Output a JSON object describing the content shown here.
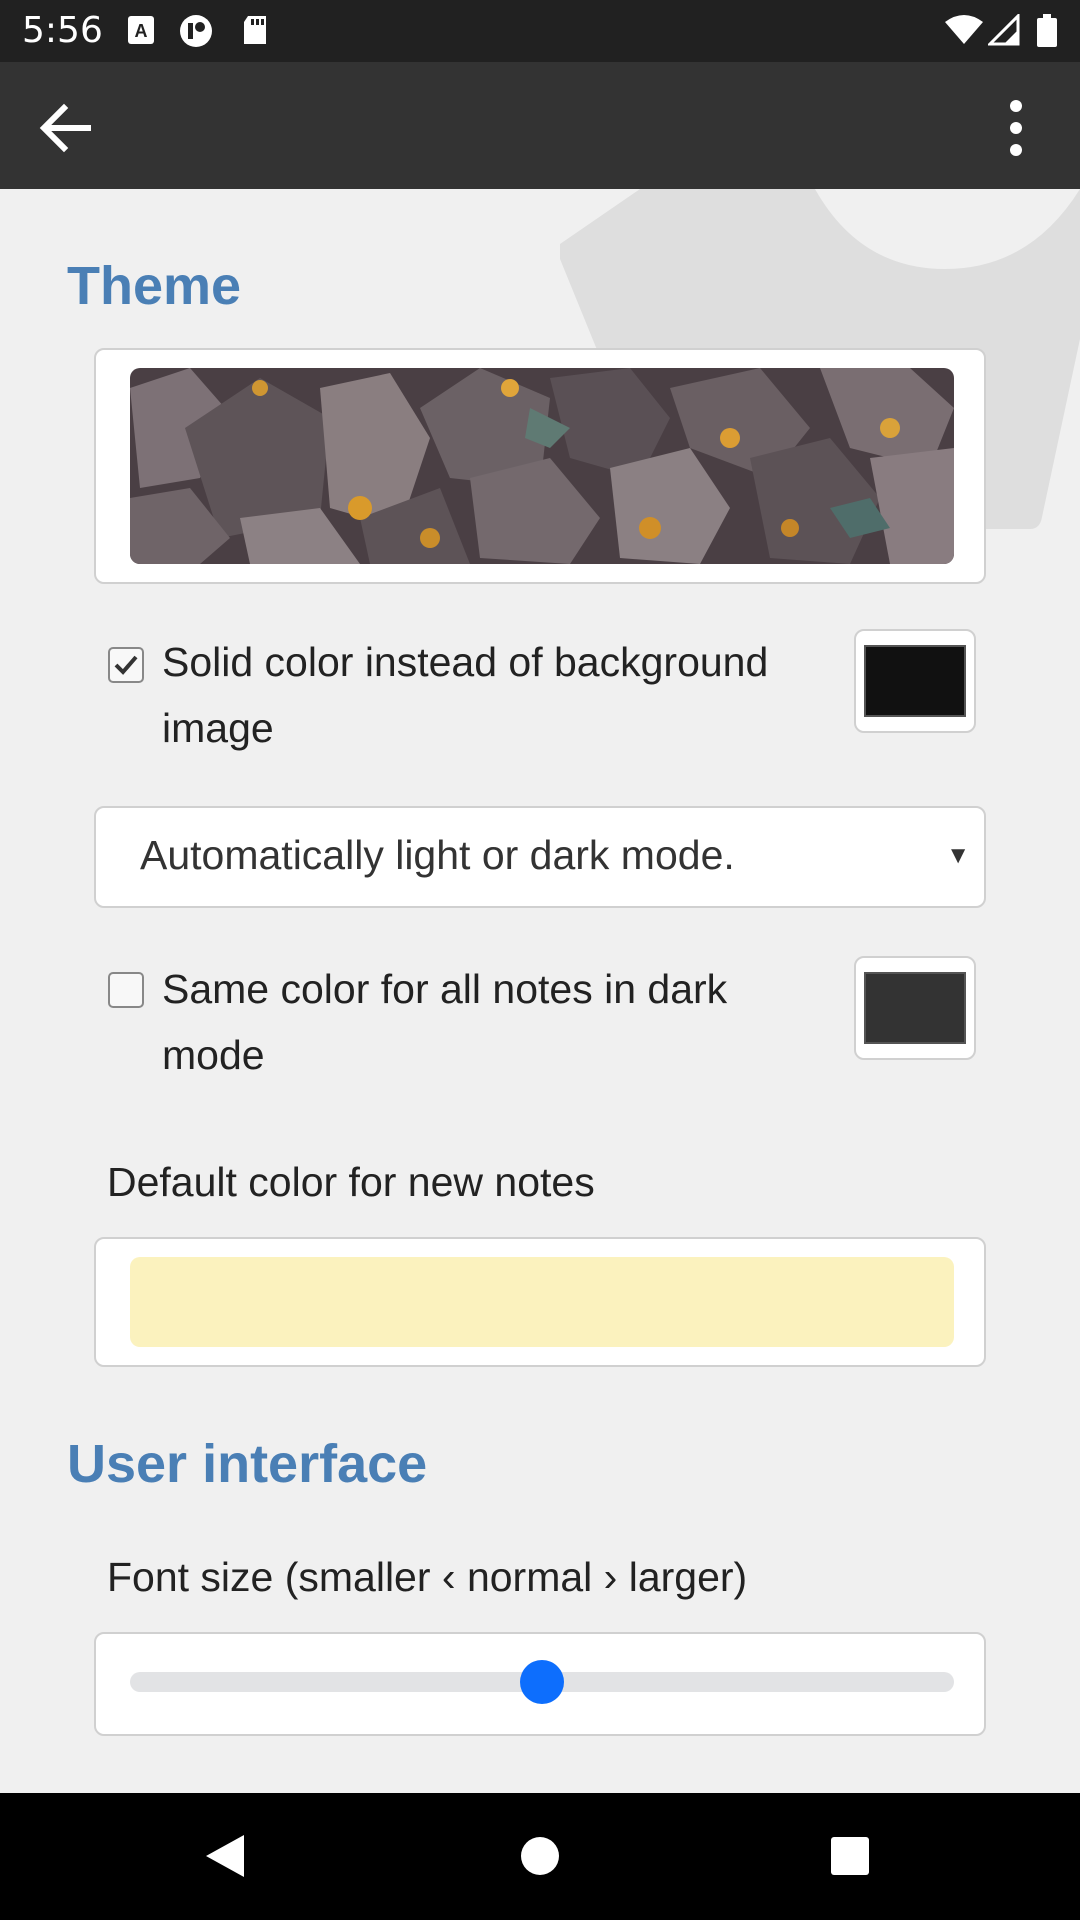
{
  "status_bar": {
    "time": "5:56",
    "icons": [
      "text-recognition-icon",
      "app-icon",
      "sd-card-icon",
      "wifi-icon",
      "signal-icon",
      "battery-icon"
    ]
  },
  "app_bar": {
    "back_icon": "arrow-left-icon",
    "menu_icon": "more-vert-icon"
  },
  "theme_section": {
    "title": "Theme",
    "background_image": "rocks-photo",
    "solid_color_option": {
      "label": "Solid color instead of background image",
      "checked": true,
      "swatch_color": "#111111"
    },
    "mode_select": {
      "value": "Automatically light or dark mode."
    },
    "dark_mode_option": {
      "label": "Same color for all notes in dark mode",
      "checked": false,
      "swatch_color": "#333333"
    },
    "default_color": {
      "label": "Default color for new notes",
      "color": "#fbf2be"
    }
  },
  "ui_section": {
    "title": "User interface",
    "font_size": {
      "label": "Font size (smaller ‹ normal › larger)",
      "value": 0.5
    }
  },
  "colors": {
    "accent": "#4a7fb5",
    "slider_thumb": "#0d6efd",
    "app_bar": "#333333",
    "status_bar": "#212121"
  },
  "nav_bar": {
    "icons": [
      "back-triangle-icon",
      "home-circle-icon",
      "recents-square-icon"
    ]
  }
}
